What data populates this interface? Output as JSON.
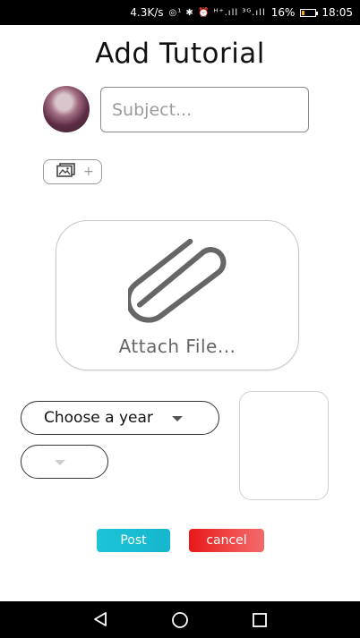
{
  "status_bar": {
    "speed": "4.3K/s",
    "icons": "◎¹ ✱ ⏰ ᴴ⁺.ıll ³ᴳ.ıll",
    "battery": "16%",
    "time": "18:05"
  },
  "page": {
    "title": "Add Tutorial"
  },
  "subject": {
    "placeholder": "Subject..."
  },
  "add_image": {
    "icon": "image-icon",
    "plus": "+"
  },
  "attach": {
    "icon": "paperclip-icon",
    "label": "Attach File..."
  },
  "year_dropdown": {
    "selected": "Choose a year"
  },
  "actions": {
    "post_label": "Post",
    "cancel_label": "cancel"
  },
  "colors": {
    "post": "#1cc4d6",
    "cancel": "#e81818"
  }
}
